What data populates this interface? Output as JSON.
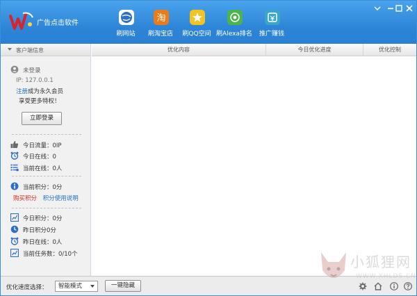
{
  "app": {
    "title": "广告点击软件"
  },
  "nav": [
    {
      "label": "刷网站",
      "icon": "globe-icon",
      "color": "#2f6fc4"
    },
    {
      "label": "刷淘宝店",
      "icon": "taobao-icon",
      "color": "#f07a16"
    },
    {
      "label": "刷QQ空间",
      "icon": "star-icon",
      "color": "#e9b31c"
    },
    {
      "label": "刷Alexa排名",
      "icon": "at-sign-icon",
      "color": "#4cb44c"
    },
    {
      "label": "推广赚钱",
      "icon": "money-icon",
      "color": "#3aa7c9"
    }
  ],
  "window_controls": {
    "menu": "▾",
    "minimize": "—",
    "maximize": "□",
    "close": "✕"
  },
  "sidebar": {
    "header": "客户端信息",
    "login_status": "未登录",
    "ip": "IP: 127.0.0.1",
    "register_link": "注册",
    "register_rest": "成为永久会员",
    "privilege": "享受更多特权！",
    "login_button": "立即登录",
    "stats1": [
      {
        "icon": "thumb-icon",
        "text": "今日流量：0IP"
      },
      {
        "icon": "alarm-clock-icon",
        "text": "今日在线：0"
      },
      {
        "icon": "list-icon",
        "text": "当前在线：0人"
      }
    ],
    "points": {
      "icon": "info-icon",
      "text": "当前积分：0分"
    },
    "buy_points": "购买积分",
    "points_help": "积分使用说明",
    "stats2": [
      {
        "icon": "chart-icon",
        "text": "今日积分：0分"
      },
      {
        "icon": "clock-icon",
        "text": "昨日积分0分"
      },
      {
        "icon": "alarm-clock-icon",
        "text": "昨日在线：0人"
      },
      {
        "icon": "chart-icon",
        "text": "当前任务数：0/10个"
      }
    ]
  },
  "table": {
    "columns": [
      "优化内容",
      "今日优化进度",
      "优化控制"
    ]
  },
  "bottom": {
    "speed_label": "优化速度选择：",
    "speed_value": "智能模式",
    "hide_button": "一键隐藏"
  },
  "watermark": {
    "text1": "小狐狸网",
    "text2": "WWW.XHLDS.CN"
  },
  "colors": {
    "header_blue": "#2e86d8",
    "link_blue": "#1f6fc9",
    "buy_red": "#d9261c"
  }
}
